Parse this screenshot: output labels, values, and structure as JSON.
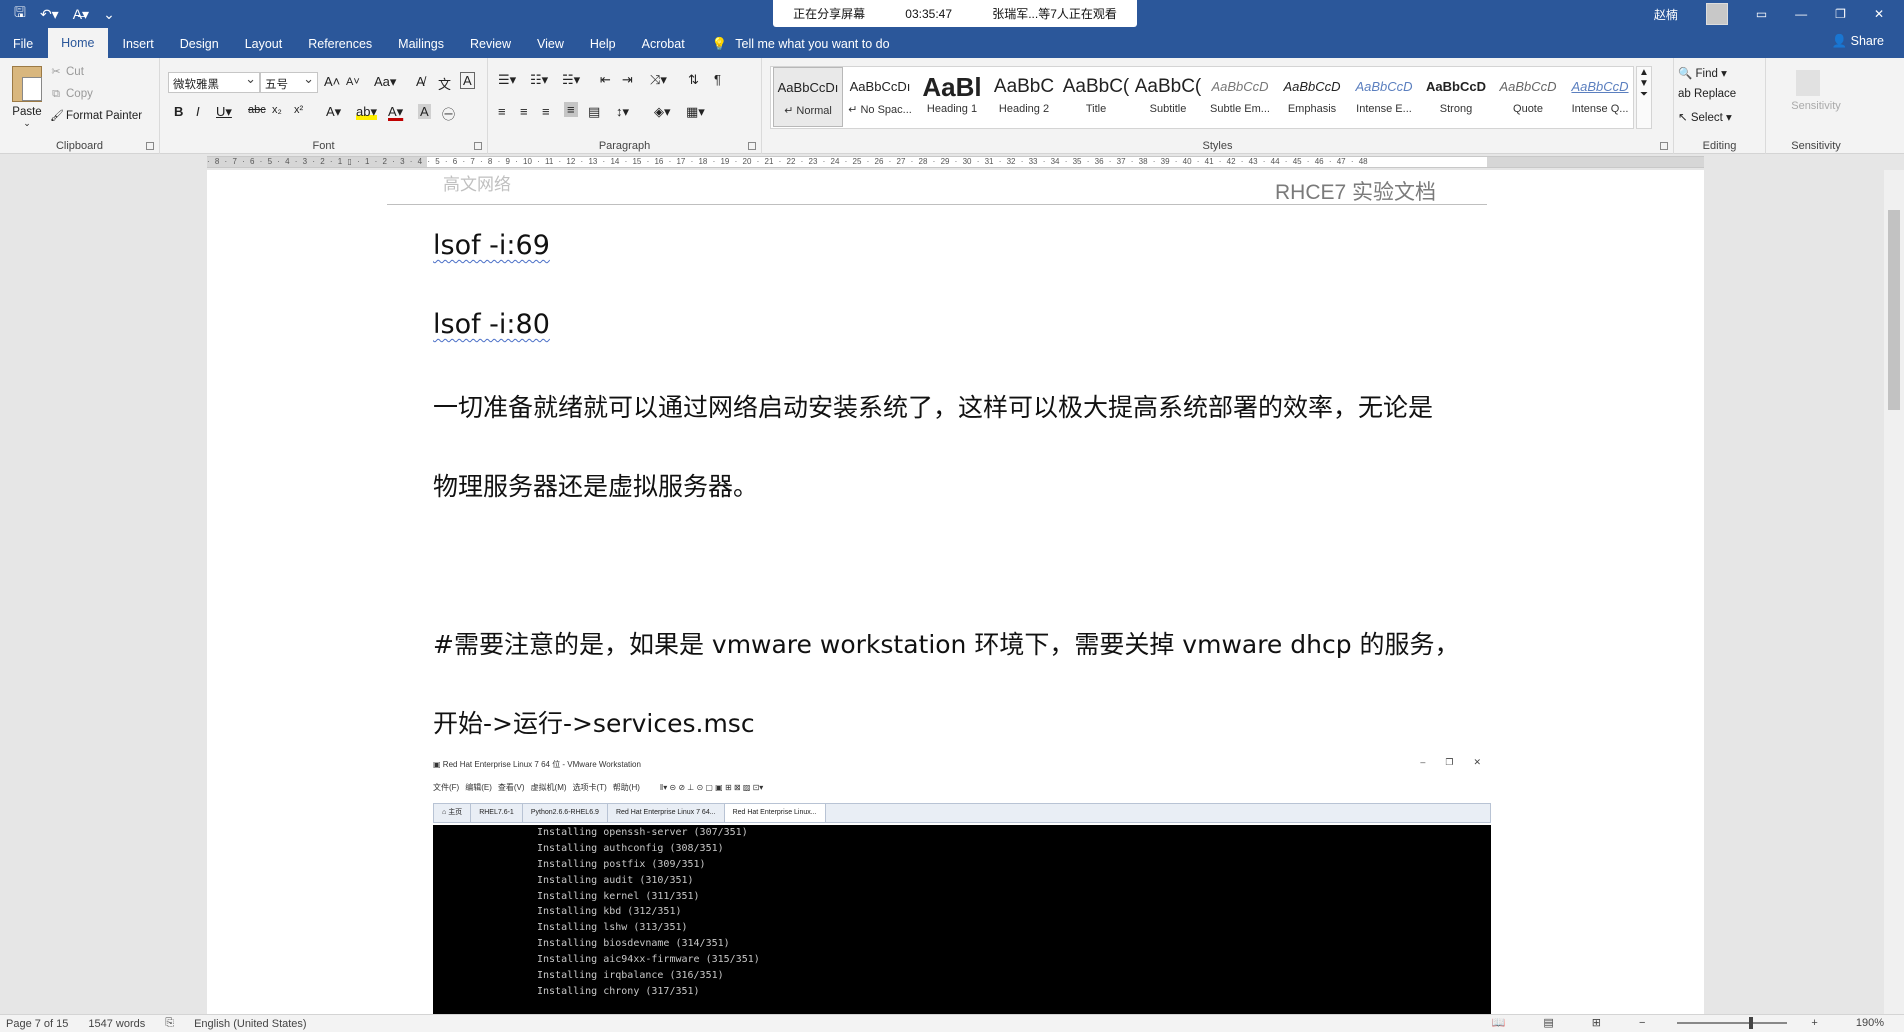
{
  "titlebar": {
    "share_status": "正在分享屏幕",
    "share_time": "03:35:47",
    "viewers": "张瑞军...等7人正在观看",
    "user": "赵楠"
  },
  "tabs": [
    "File",
    "Home",
    "Insert",
    "Design",
    "Layout",
    "References",
    "Mailings",
    "Review",
    "View",
    "Help",
    "Acrobat"
  ],
  "tell_me": "Tell me what you want to do",
  "share_label": "Share",
  "ribbon": {
    "clipboard": {
      "paste": "Paste",
      "cut": "Cut",
      "copy": "Copy",
      "format_painter": "Format Painter",
      "label": "Clipboard"
    },
    "font": {
      "family": "微软雅黑",
      "size": "五号",
      "case": "Aa",
      "label": "Font"
    },
    "paragraph": {
      "label": "Paragraph"
    },
    "styles": {
      "label": "Styles",
      "items": [
        {
          "sample": "AaBbCcDı",
          "name": "↵ Normal"
        },
        {
          "sample": "AaBbCcDı",
          "name": "↵ No Spac..."
        },
        {
          "sample": "AaBl",
          "name": "Heading 1"
        },
        {
          "sample": "AaBbC",
          "name": "Heading 2"
        },
        {
          "sample": "AaBbC(",
          "name": "Title"
        },
        {
          "sample": "AaBbC(",
          "name": "Subtitle"
        },
        {
          "sample": "AaBbCcD",
          "name": "Subtle Em..."
        },
        {
          "sample": "AaBbCcD",
          "name": "Emphasis"
        },
        {
          "sample": "AaBbCcD",
          "name": "Intense E..."
        },
        {
          "sample": "AaBbCcD",
          "name": "Strong"
        },
        {
          "sample": "AaBbCcD",
          "name": "Quote"
        },
        {
          "sample": "AaBbCcD",
          "name": "Intense Q..."
        }
      ]
    },
    "editing": {
      "find": "Find",
      "replace": "Replace",
      "select": "Select",
      "label": "Editing"
    },
    "sensitivity": {
      "button": "Sensitivity",
      "label": "Sensitivity"
    }
  },
  "document": {
    "header_right": "RHCE7  实验文档",
    "header_ghost": "高文网络",
    "lines": [
      "lsof -i:69",
      "lsof -i:80",
      "一切准备就绪就可以通过网络启动安装系统了，这样可以极大提高系统部署的效率，无论是",
      "物理服务器还是虚拟服务器。",
      "#需要注意的是，如果是 vmware  workstation 环境下，需要关掉 vmware  dhcp 的服务，",
      "开始->运行->services.msc"
    ]
  },
  "vm": {
    "title": "Red Hat Enterprise Linux 7 64 位 - VMware Workstation",
    "menu": [
      "文件(F)",
      "编辑(E)",
      "查看(V)",
      "虚拟机(M)",
      "选项卡(T)",
      "帮助(H)"
    ],
    "tabs": [
      "主页",
      "RHEL7.6-1",
      "Python2.6.6-RHEL6.9",
      "Red Hat Enterprise Linux 7 64...",
      "Red Hat Enterprise Linux..."
    ],
    "console": [
      "Installing openssh-server (307/351)",
      "Installing authconfig (308/351)",
      "Installing postfix (309/351)",
      "Installing audit (310/351)",
      "Installing kernel (311/351)",
      "Installing kbd (312/351)",
      "Installing lshw (313/351)",
      "Installing biosdevname (314/351)",
      "Installing aic94xx-firmware (315/351)",
      "Installing irqbalance (316/351)",
      "Installing chrony (317/351)"
    ]
  },
  "status": {
    "page": "Page 7 of 15",
    "words": "1547 words",
    "language": "English (United States)",
    "zoom": "190%"
  },
  "colors": {
    "word_blue": "#2b579a",
    "ribbon_bg": "#f3f3f3"
  }
}
